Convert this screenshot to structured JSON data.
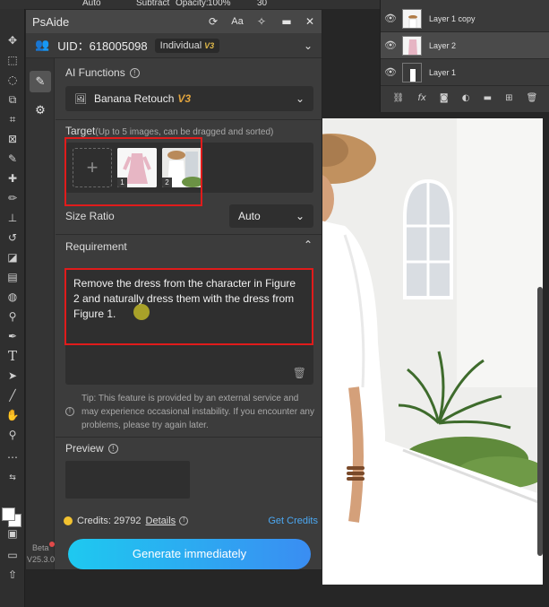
{
  "ps_topbar": {
    "items": [
      "Auto",
      "Subtract",
      "Opacity:",
      "100%",
      "30"
    ]
  },
  "layers": [
    {
      "name": "Layer 1 copy",
      "selected": false
    },
    {
      "name": "Layer 2",
      "selected": true
    },
    {
      "name": "Layer 1",
      "selected": false
    }
  ],
  "layer_tools": [
    "link-icon",
    "fx-icon",
    "mask-icon",
    "adjust-icon",
    "folder-icon",
    "new-layer-icon",
    "delete-icon"
  ],
  "panel": {
    "title": "PsAide",
    "controls": [
      "refresh-icon",
      "font-size-icon",
      "pin-icon",
      "minimize-icon",
      "close-icon"
    ],
    "user": {
      "uid_label": "UID：618005098",
      "plan": "Individual",
      "plan_version": "V3"
    },
    "nav": [
      "edit-icon",
      "settings-icon"
    ],
    "ai_functions": {
      "label": "AI Functions",
      "selected": "Banana Retouch",
      "selected_version": "V3"
    },
    "target": {
      "label": "Target",
      "hint": "(Up to 5 images, can be dragged and sorted)",
      "images": [
        {
          "index": "1"
        },
        {
          "index": "2"
        }
      ]
    },
    "size_ratio": {
      "label": "Size Ratio",
      "value": "Auto"
    },
    "requirement": {
      "label": "Requirement",
      "text": "Remove the dress from the character in Figure 2 and naturally dress them with the dress from Figure 1."
    },
    "tip": "Tip: This feature is provided by an external service and may experience occasional instability. If you encounter any problems, please try again later.",
    "preview": {
      "label": "Preview"
    },
    "credits": {
      "text": "Credits: 29792",
      "details": "Details",
      "get_credits": "Get Credits"
    },
    "generate_label": "Generate immediately"
  },
  "footer": {
    "beta": "Beta",
    "version": "V25.3.0"
  },
  "colors": {
    "accent_gradient_start": "#1ec9f0",
    "accent_gradient_end": "#3a8df2",
    "highlight_box": "#e01b1b",
    "version_badge": "#e2a53e",
    "credits_link": "#4ca8f2"
  }
}
